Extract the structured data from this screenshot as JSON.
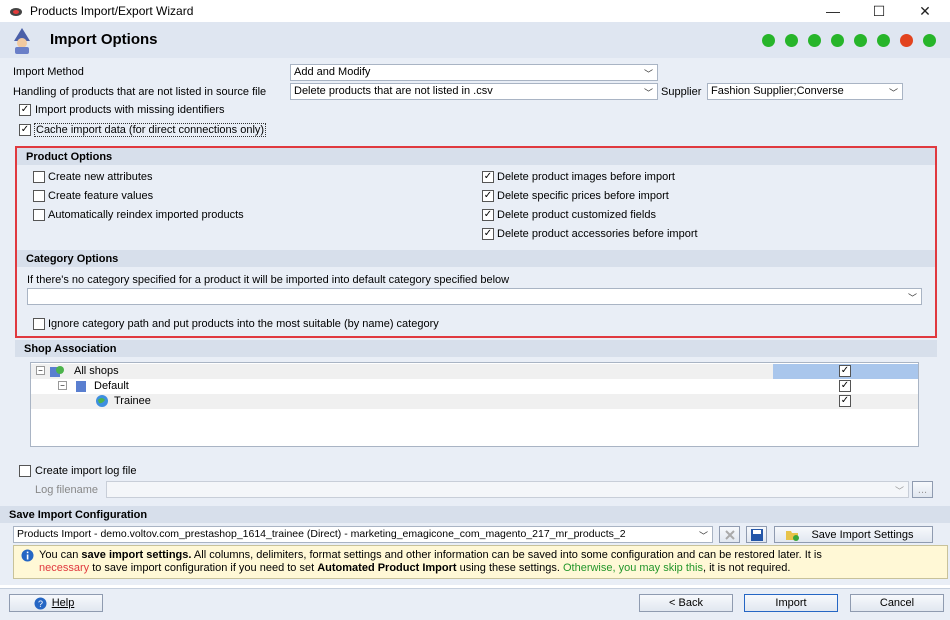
{
  "window": {
    "title": "Products Import/Export Wizard",
    "minimize": "—",
    "maximize": "☐",
    "close": "✕"
  },
  "header": {
    "title": "Import Options",
    "steps": [
      "#27b52a",
      "#27b52a",
      "#27b52a",
      "#27b52a",
      "#27b52a",
      "#27b52a",
      "#e2431e",
      "#27b52a"
    ]
  },
  "import_method": {
    "label": "Import Method",
    "value": "Add and Modify"
  },
  "handling": {
    "label": "Handling of products that are not listed in source file",
    "value": "Delete products that are not listed in .csv"
  },
  "supplier": {
    "label": "Supplier",
    "value": "Fashion Supplier;Converse"
  },
  "options": {
    "missing_identifiers": {
      "label": "Import products with missing identifiers",
      "checked": true
    },
    "cache": {
      "label": "Cache import data (for direct connections only)",
      "checked": true
    }
  },
  "product_options": {
    "title": "Product Options",
    "left": [
      {
        "label": "Create new attributes",
        "checked": false
      },
      {
        "label": "Create feature values",
        "checked": false
      },
      {
        "label": "Automatically reindex imported products",
        "checked": false
      }
    ],
    "right": [
      {
        "label": "Delete product images before import",
        "checked": true
      },
      {
        "label": "Delete specific prices before import",
        "checked": true
      },
      {
        "label": "Delete product customized fields",
        "checked": true
      },
      {
        "label": "Delete product accessories before import",
        "checked": true
      }
    ]
  },
  "category_options": {
    "title": "Category Options",
    "desc": "If there's no category specified for a product it will be imported into default category specified below",
    "value": "",
    "ignore_label": "Ignore category path and put products into the most suitable (by name) category",
    "ignore_checked": false
  },
  "shop_association": {
    "title": "Shop Association",
    "rows": [
      {
        "label": "All shops",
        "checked": true
      },
      {
        "label": "Default",
        "checked": true
      },
      {
        "label": "Trainee",
        "checked": true
      }
    ]
  },
  "log": {
    "create_label": "Create import log file",
    "create_checked": false,
    "filename_label": "Log filename",
    "browse": "..."
  },
  "save_config": {
    "title": "Save Import Configuration",
    "value": "Products Import - demo.voltov.com_prestashop_1614_trainee (Direct) - marketing_emagicone_com_magento_217_mr_products_2",
    "save_button": "Save Import Settings"
  },
  "info": {
    "p1": "You can ",
    "p2": "save import settings.",
    "p3": " All columns, delimiters, format settings and other information can be saved into some configuration and can be restored later. It is",
    "p4": "necessary",
    "p5": " to save import configuration if you need to set ",
    "p6": "Automated Product Import",
    "p7": " using these settings. ",
    "p8": "Otherwise, you may skip this",
    "p9": ", it is not required."
  },
  "footer": {
    "help": "Help",
    "back": "< Back",
    "import": "Import",
    "cancel": "Cancel"
  },
  "colors": {
    "red": "#e0393f",
    "green": "#27b52a",
    "accent": "#2566c4"
  }
}
